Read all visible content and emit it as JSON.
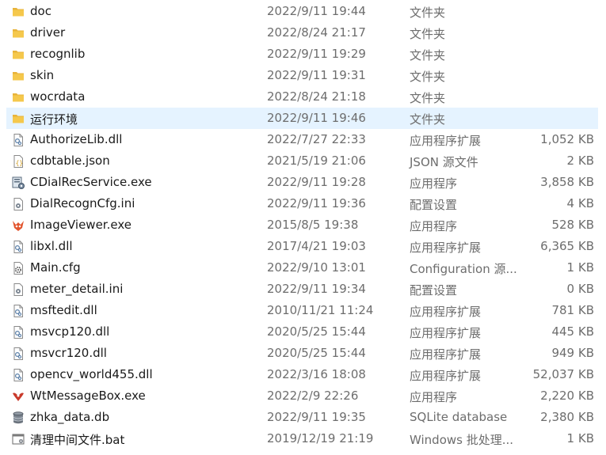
{
  "files": [
    {
      "name": "doc",
      "date": "2022/9/11 19:44",
      "type": "文件夹",
      "size": "",
      "icon": "folder-icon"
    },
    {
      "name": "driver",
      "date": "2022/8/24 21:17",
      "type": "文件夹",
      "size": "",
      "icon": "folder-icon"
    },
    {
      "name": "recognlib",
      "date": "2022/9/11 19:29",
      "type": "文件夹",
      "size": "",
      "icon": "folder-icon"
    },
    {
      "name": "skin",
      "date": "2022/9/11 19:31",
      "type": "文件夹",
      "size": "",
      "icon": "folder-icon"
    },
    {
      "name": "wocrdata",
      "date": "2022/8/24 21:18",
      "type": "文件夹",
      "size": "",
      "icon": "folder-icon"
    },
    {
      "name": "运行环境",
      "date": "2022/9/11 19:46",
      "type": "文件夹",
      "size": "",
      "icon": "folder-icon",
      "selected": true
    },
    {
      "name": "AuthorizeLib.dll",
      "date": "2022/7/27 22:33",
      "type": "应用程序扩展",
      "size": "1,052 KB",
      "icon": "dll-icon"
    },
    {
      "name": "cdbtable.json",
      "date": "2021/5/19 21:06",
      "type": "JSON 源文件",
      "size": "2 KB",
      "icon": "json-icon"
    },
    {
      "name": "CDialRecService.exe",
      "date": "2022/9/11 19:28",
      "type": "应用程序",
      "size": "3,858 KB",
      "icon": "service-exe-icon"
    },
    {
      "name": "DialRecognCfg.ini",
      "date": "2022/9/11 19:36",
      "type": "配置设置",
      "size": "4 KB",
      "icon": "ini-icon"
    },
    {
      "name": "ImageViewer.exe",
      "date": "2015/8/5 19:38",
      "type": "应用程序",
      "size": "528 KB",
      "icon": "image-viewer-icon"
    },
    {
      "name": "libxl.dll",
      "date": "2017/4/21 19:03",
      "type": "应用程序扩展",
      "size": "6,365 KB",
      "icon": "dll-icon"
    },
    {
      "name": "Main.cfg",
      "date": "2022/9/10 13:01",
      "type": "Configuration 源...",
      "size": "1 KB",
      "icon": "cfg-icon"
    },
    {
      "name": "meter_detail.ini",
      "date": "2022/9/11 19:34",
      "type": "配置设置",
      "size": "0 KB",
      "icon": "ini-icon"
    },
    {
      "name": "msftedit.dll",
      "date": "2010/11/21 11:24",
      "type": "应用程序扩展",
      "size": "781 KB",
      "icon": "dll-icon"
    },
    {
      "name": "msvcp120.dll",
      "date": "2020/5/25 15:44",
      "type": "应用程序扩展",
      "size": "445 KB",
      "icon": "dll-icon"
    },
    {
      "name": "msvcr120.dll",
      "date": "2020/5/25 15:44",
      "type": "应用程序扩展",
      "size": "949 KB",
      "icon": "dll-icon"
    },
    {
      "name": "opencv_world455.dll",
      "date": "2022/3/16 18:08",
      "type": "应用程序扩展",
      "size": "52,037 KB",
      "icon": "dll-icon"
    },
    {
      "name": "WtMessageBox.exe",
      "date": "2022/2/9 22:26",
      "type": "应用程序",
      "size": "2,220 KB",
      "icon": "message-box-icon"
    },
    {
      "name": "zhka_data.db",
      "date": "2022/9/11 19:35",
      "type": "SQLite database",
      "size": "2,380 KB",
      "icon": "database-icon"
    },
    {
      "name": "清理中间文件.bat",
      "date": "2019/12/19 21:19",
      "type": "Windows 批处理...",
      "size": "1 KB",
      "icon": "batch-file-icon"
    }
  ],
  "colors": {
    "selected_row": "#e5f3ff",
    "folder": "#f0c14b",
    "secondary_text": "#6d6d6d"
  }
}
